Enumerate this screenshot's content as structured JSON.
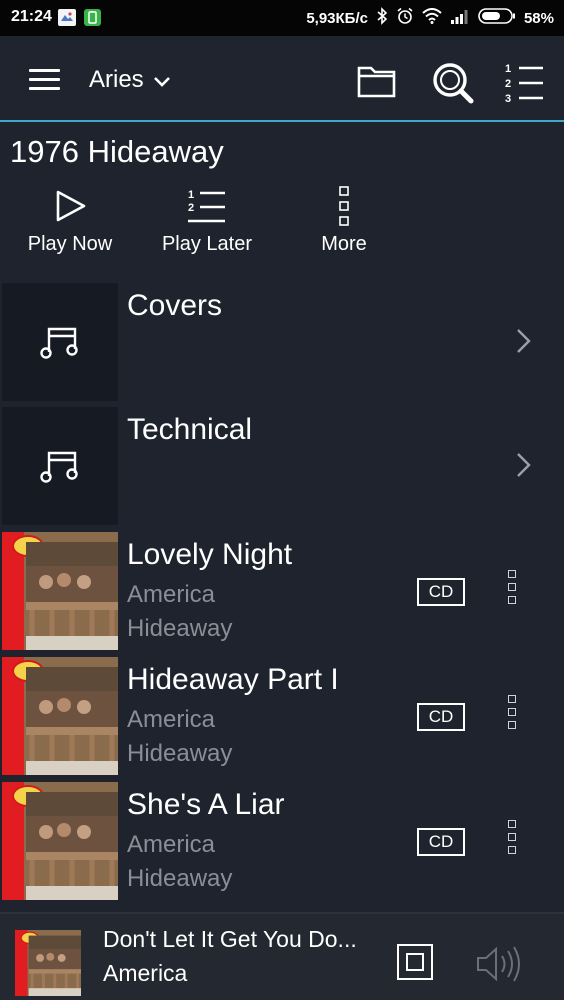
{
  "status_bar": {
    "time": "21:24",
    "network_speed": "5,93КБ/с",
    "battery": "58%",
    "icons": [
      "gallery-icon",
      "battery-app-icon",
      "bluetooth-icon",
      "alarm-icon",
      "wifi-icon",
      "signal-icon",
      "battery-icon"
    ]
  },
  "top_bar": {
    "zone_name": "Aries",
    "icons": [
      "menu-icon",
      "chevron-down-icon",
      "folder-icon",
      "search-icon",
      "queue-icon"
    ]
  },
  "page": {
    "title": "1976 Hideaway"
  },
  "actions": [
    {
      "label": "Play Now",
      "icon": "play-icon"
    },
    {
      "label": "Play Later",
      "icon": "queue-list-icon"
    },
    {
      "label": "More",
      "icon": "more-icon"
    }
  ],
  "folders": [
    {
      "title": "Covers",
      "icon": "music-note-icon"
    },
    {
      "title": "Technical",
      "icon": "music-note-icon"
    }
  ],
  "tracks": [
    {
      "title": "Lovely Night",
      "artist": "America",
      "album": "Hideaway",
      "format": "CD"
    },
    {
      "title": "Hideaway Part I",
      "artist": "America",
      "album": "Hideaway",
      "format": "CD"
    },
    {
      "title": "She's A Liar",
      "artist": "America",
      "album": "Hideaway",
      "format": "CD"
    }
  ],
  "now_playing": {
    "title": "Don't Let It Get You Do...",
    "artist": "America"
  },
  "colors": {
    "background": "#1e232d",
    "accent_line": "#3fa7c9",
    "secondary_text": "#8a8f97"
  }
}
